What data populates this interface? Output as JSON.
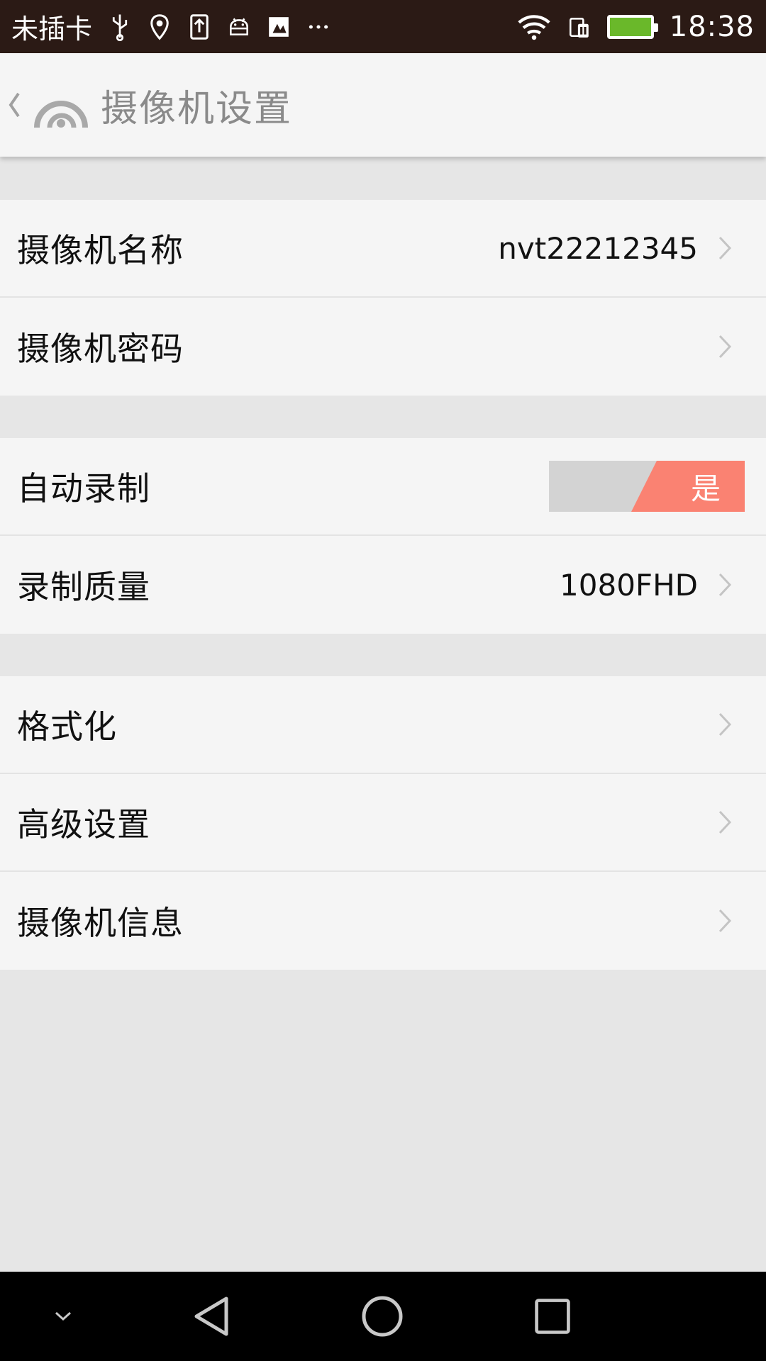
{
  "status_bar": {
    "carrier": "未插卡",
    "time": "18:38",
    "icons": [
      "usb-icon",
      "location-icon",
      "upload-icon",
      "android-icon",
      "image-icon",
      "more-icon",
      "wifi-icon",
      "sim-icon",
      "battery-icon"
    ],
    "battery_color": "#6ab82a"
  },
  "app_bar": {
    "title": "摄像机设置"
  },
  "settings": {
    "camera_name": {
      "label": "摄像机名称",
      "value": "nvt22212345"
    },
    "camera_password": {
      "label": "摄像机密码"
    },
    "auto_record": {
      "label": "自动录制",
      "toggle_label": "是",
      "on": true
    },
    "record_quality": {
      "label": "录制质量",
      "value": "1080FHD"
    },
    "format": {
      "label": "格式化"
    },
    "advanced": {
      "label": "高级设置"
    },
    "camera_info": {
      "label": "摄像机信息"
    }
  },
  "colors": {
    "accent": "#fa8272",
    "toggle_off": "#d3d3d3",
    "status_bar": "#2b1a15",
    "background": "#e6e6e6",
    "row_background": "#f5f5f5"
  }
}
